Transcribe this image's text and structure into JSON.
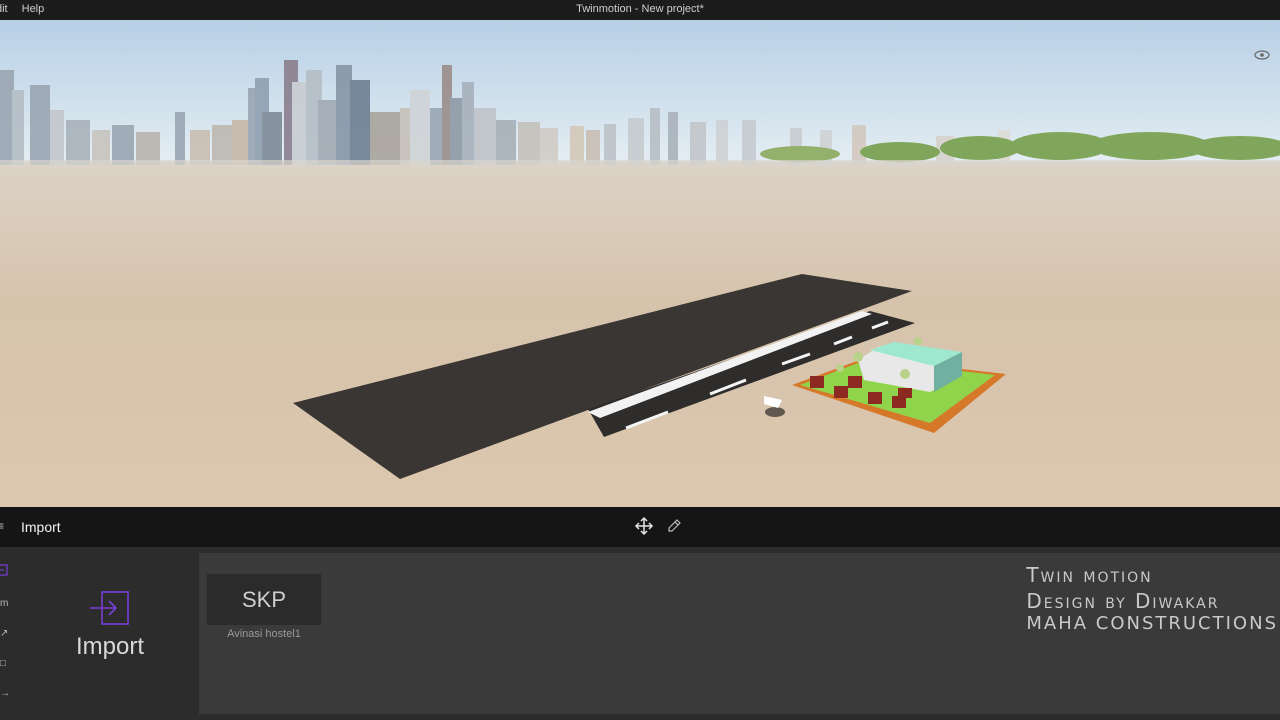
{
  "menu": {
    "edit": "dit",
    "help": "Help"
  },
  "window": {
    "title": "Twinmotion - New project*"
  },
  "toolbar": {
    "section_label": "Import"
  },
  "library": {
    "import_label": "Import",
    "items": [
      {
        "type": "SKP",
        "name": "Avinasi hostel1"
      }
    ]
  },
  "watermark": {
    "line1": "Twin motion",
    "line2": "Design by Diwakar",
    "line3": "MAHA CONSTRUCTIONS"
  },
  "colors": {
    "accent": "#7a3fd6",
    "sky_top": "#b9d2e6",
    "ground": "#d9c9b5",
    "road": "#3a3633",
    "lawn": "#8fd44a"
  },
  "icons": {
    "view": "eye-icon",
    "move": "move-icon",
    "edit": "pen-icon",
    "import": "import-icon"
  }
}
